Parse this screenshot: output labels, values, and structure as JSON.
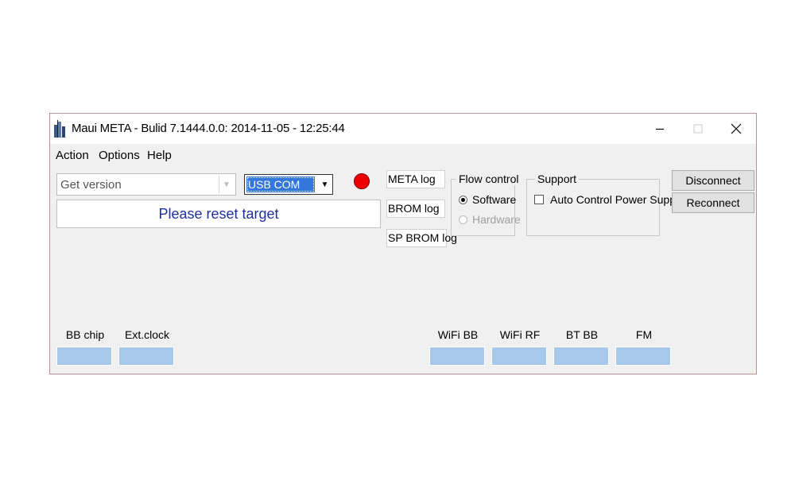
{
  "window": {
    "title": "Maui META - Bulid 7.1444.0.0: 2014-11-05 - 12:25:44",
    "controls": {
      "minimize": "‒",
      "maximize": "☐",
      "close": "✕"
    }
  },
  "menu": {
    "items": [
      "Action",
      "Options",
      "Help"
    ]
  },
  "toolbar": {
    "function_select": {
      "value": "Get version",
      "arrow": "▼"
    },
    "port_select": {
      "value": "USB COM",
      "arrow": "▼"
    },
    "status_led_color": "#ee0000",
    "message": "Please reset target",
    "message_color": "#1f2fa0"
  },
  "logs": [
    "META log",
    "BROM log",
    "SP BROM log"
  ],
  "flow_control": {
    "title": "Flow control",
    "options": [
      {
        "label": "Software",
        "selected": true,
        "enabled": true
      },
      {
        "label": "Hardware",
        "selected": false,
        "enabled": false
      }
    ]
  },
  "support": {
    "title": "Support",
    "auto_control_power_supply": {
      "label": "Auto Control Power Supply",
      "checked": false
    }
  },
  "buttons": {
    "disconnect": "Disconnect",
    "reconnect": "Reconnect"
  },
  "info_fields": {
    "left": [
      "BB chip",
      "Ext.clock"
    ],
    "right": [
      "WiFi BB",
      "WiFi RF",
      "BT BB",
      "FM"
    ],
    "field_color": "#a8c8ea"
  }
}
